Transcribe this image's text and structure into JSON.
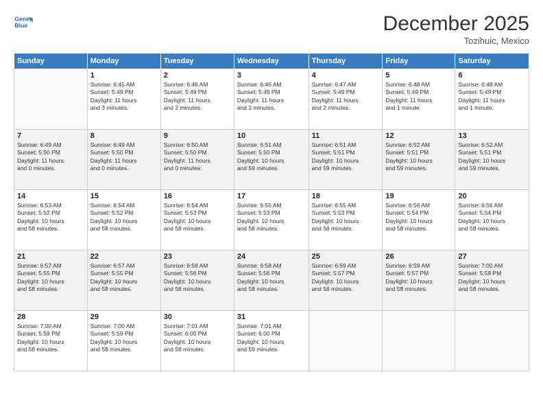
{
  "header": {
    "logo_line1": "General",
    "logo_line2": "Blue",
    "month": "December 2025",
    "location": "Tozihuic, Mexico"
  },
  "days_of_week": [
    "Sunday",
    "Monday",
    "Tuesday",
    "Wednesday",
    "Thursday",
    "Friday",
    "Saturday"
  ],
  "weeks": [
    [
      {
        "day": "",
        "info": ""
      },
      {
        "day": "1",
        "info": "Sunrise: 6:45 AM\nSunset: 5:49 PM\nDaylight: 11 hours\nand 3 minutes."
      },
      {
        "day": "2",
        "info": "Sunrise: 6:46 AM\nSunset: 5:49 PM\nDaylight: 11 hours\nand 2 minutes."
      },
      {
        "day": "3",
        "info": "Sunrise: 6:46 AM\nSunset: 5:49 PM\nDaylight: 11 hours\nand 2 minutes."
      },
      {
        "day": "4",
        "info": "Sunrise: 6:47 AM\nSunset: 5:49 PM\nDaylight: 11 hours\nand 2 minutes."
      },
      {
        "day": "5",
        "info": "Sunrise: 6:48 AM\nSunset: 5:49 PM\nDaylight: 11 hours\nand 1 minute."
      },
      {
        "day": "6",
        "info": "Sunrise: 6:48 AM\nSunset: 5:49 PM\nDaylight: 11 hours\nand 1 minute."
      }
    ],
    [
      {
        "day": "7",
        "info": "Sunrise: 6:49 AM\nSunset: 5:50 PM\nDaylight: 11 hours\nand 0 minutes."
      },
      {
        "day": "8",
        "info": "Sunrise: 6:49 AM\nSunset: 5:50 PM\nDaylight: 11 hours\nand 0 minutes."
      },
      {
        "day": "9",
        "info": "Sunrise: 6:50 AM\nSunset: 5:50 PM\nDaylight: 11 hours\nand 0 minutes."
      },
      {
        "day": "10",
        "info": "Sunrise: 6:51 AM\nSunset: 5:50 PM\nDaylight: 10 hours\nand 59 minutes."
      },
      {
        "day": "11",
        "info": "Sunrise: 6:51 AM\nSunset: 5:51 PM\nDaylight: 10 hours\nand 59 minutes."
      },
      {
        "day": "12",
        "info": "Sunrise: 6:52 AM\nSunset: 5:51 PM\nDaylight: 10 hours\nand 59 minutes."
      },
      {
        "day": "13",
        "info": "Sunrise: 6:52 AM\nSunset: 5:51 PM\nDaylight: 10 hours\nand 59 minutes."
      }
    ],
    [
      {
        "day": "14",
        "info": "Sunrise: 6:53 AM\nSunset: 5:52 PM\nDaylight: 10 hours\nand 58 minutes."
      },
      {
        "day": "15",
        "info": "Sunrise: 6:54 AM\nSunset: 5:52 PM\nDaylight: 10 hours\nand 58 minutes."
      },
      {
        "day": "16",
        "info": "Sunrise: 6:54 AM\nSunset: 5:53 PM\nDaylight: 10 hours\nand 58 minutes."
      },
      {
        "day": "17",
        "info": "Sunrise: 6:55 AM\nSunset: 5:53 PM\nDaylight: 10 hours\nand 58 minutes."
      },
      {
        "day": "18",
        "info": "Sunrise: 6:55 AM\nSunset: 5:53 PM\nDaylight: 10 hours\nand 58 minutes."
      },
      {
        "day": "19",
        "info": "Sunrise: 6:56 AM\nSunset: 5:54 PM\nDaylight: 10 hours\nand 58 minutes."
      },
      {
        "day": "20",
        "info": "Sunrise: 6:56 AM\nSunset: 5:54 PM\nDaylight: 10 hours\nand 58 minutes."
      }
    ],
    [
      {
        "day": "21",
        "info": "Sunrise: 6:57 AM\nSunset: 5:55 PM\nDaylight: 10 hours\nand 58 minutes."
      },
      {
        "day": "22",
        "info": "Sunrise: 6:57 AM\nSunset: 5:55 PM\nDaylight: 10 hours\nand 58 minutes."
      },
      {
        "day": "23",
        "info": "Sunrise: 6:58 AM\nSunset: 5:56 PM\nDaylight: 10 hours\nand 58 minutes."
      },
      {
        "day": "24",
        "info": "Sunrise: 6:58 AM\nSunset: 5:56 PM\nDaylight: 10 hours\nand 58 minutes."
      },
      {
        "day": "25",
        "info": "Sunrise: 6:59 AM\nSunset: 5:57 PM\nDaylight: 10 hours\nand 58 minutes."
      },
      {
        "day": "26",
        "info": "Sunrise: 6:59 AM\nSunset: 5:57 PM\nDaylight: 10 hours\nand 58 minutes."
      },
      {
        "day": "27",
        "info": "Sunrise: 7:00 AM\nSunset: 5:58 PM\nDaylight: 10 hours\nand 58 minutes."
      }
    ],
    [
      {
        "day": "28",
        "info": "Sunrise: 7:00 AM\nSunset: 5:59 PM\nDaylight: 10 hours\nand 58 minutes."
      },
      {
        "day": "29",
        "info": "Sunrise: 7:00 AM\nSunset: 5:59 PM\nDaylight: 10 hours\nand 58 minutes."
      },
      {
        "day": "30",
        "info": "Sunrise: 7:01 AM\nSunset: 6:00 PM\nDaylight: 10 hours\nand 58 minutes."
      },
      {
        "day": "31",
        "info": "Sunrise: 7:01 AM\nSunset: 6:00 PM\nDaylight: 10 hours\nand 59 minutes."
      },
      {
        "day": "",
        "info": ""
      },
      {
        "day": "",
        "info": ""
      },
      {
        "day": "",
        "info": ""
      }
    ]
  ]
}
